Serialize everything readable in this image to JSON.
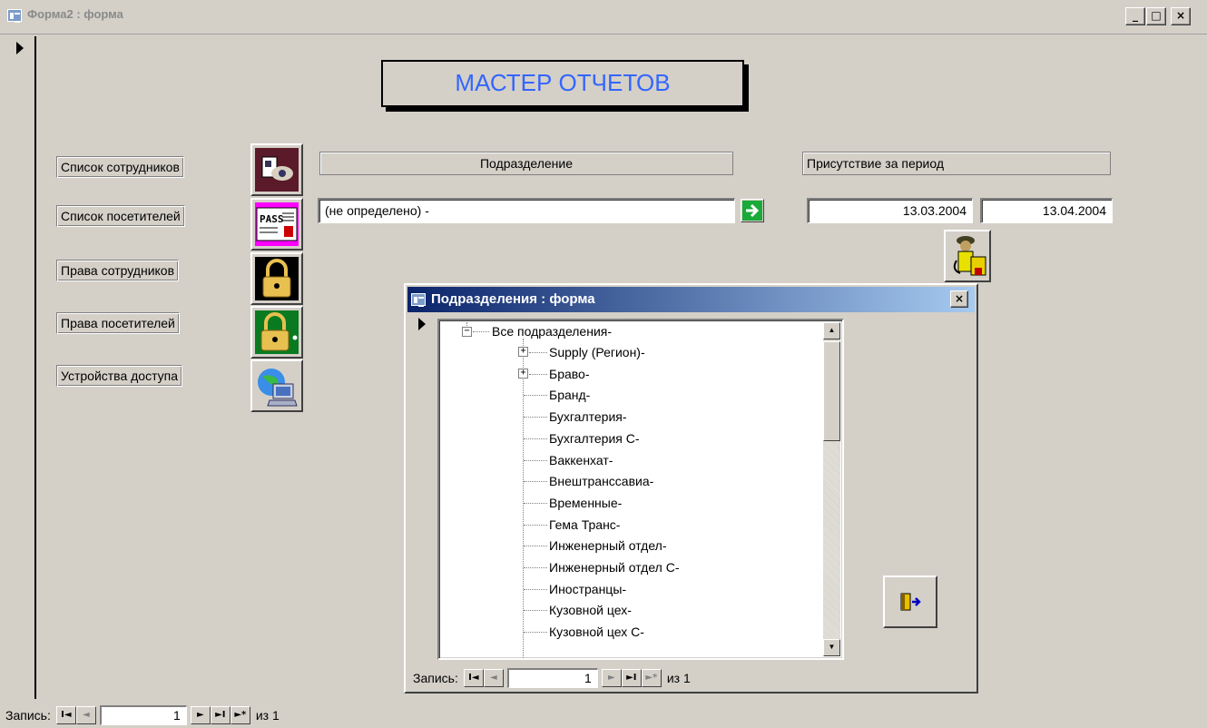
{
  "window": {
    "title": "Форма2 : форма",
    "min_glyph": "_",
    "max_glyph": "□",
    "close_glyph": "×"
  },
  "form": {
    "title": "МАСТЕР ОТЧЕТОВ",
    "buttons": [
      {
        "label": "Список сотрудников",
        "icon": "employee-card-icon"
      },
      {
        "label": "Список посетителей",
        "icon": "visitor-pass-icon"
      },
      {
        "label": "Права сотрудников",
        "icon": "padlock-icon"
      },
      {
        "label": "Права посетителей",
        "icon": "padlock-dot-icon"
      },
      {
        "label": "Устройства доступа",
        "icon": "network-computer-icon"
      }
    ],
    "department_label": "Подразделение",
    "department_value": "(не определено) -",
    "period_label": "Присутствие за период",
    "date_from": "13.03.2004",
    "date_to": "13.04.2004",
    "pass_text": "PASS"
  },
  "nav": {
    "record_label": "Запись:",
    "record_value": "1",
    "of_text": "из 1",
    "first": "I◄",
    "prev": "◄",
    "next": "►",
    "last": "►I",
    "new": "►*"
  },
  "dialog": {
    "title": "Подразделения : форма",
    "close_glyph": "×",
    "root": "Все подразделения-",
    "items": [
      "Supply (Регион)-",
      "Браво-",
      "Бранд-",
      "Бухгалтерия-",
      "Бухгалтерия С-",
      "Ваккенхат-",
      "Внештранссавиа-",
      "Временные-",
      "Гема Транс-",
      "Инженерный отдел-",
      "Инженерный отдел С-",
      "Иностранцы-",
      "Кузовной цех-",
      "Кузовной цех С-"
    ],
    "expandable": [
      true,
      true,
      false,
      false,
      false,
      false,
      false,
      false,
      false,
      false,
      false,
      false,
      false,
      false
    ],
    "nav": {
      "record_label": "Запись:",
      "record_value": "1",
      "of_text": "из 1"
    }
  },
  "colors": {
    "title_blue": "#3366ff",
    "dialog_title_start": "#0a246a",
    "dialog_title_end": "#a6caf0"
  }
}
